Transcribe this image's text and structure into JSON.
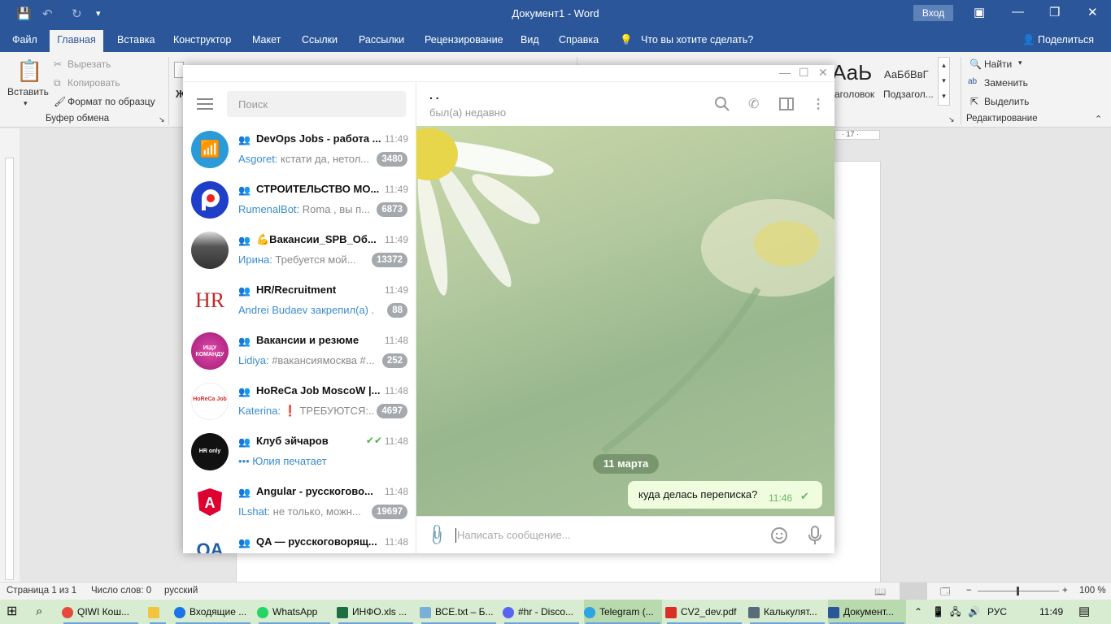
{
  "word": {
    "title": "Документ1 - Word",
    "signin": "Вход",
    "menu": [
      "Файл",
      "Главная",
      "Вставка",
      "Конструктор",
      "Макет",
      "Ссылки",
      "Рассылки",
      "Рецензирование",
      "Вид",
      "Справка"
    ],
    "tell_me": "Что вы хотите сделать?",
    "share": "Поделиться",
    "ribbon": {
      "paste": "Вставить",
      "cut": "Вырезать",
      "copy": "Копировать",
      "format_painter": "Формат по образцу",
      "clipboard_group": "Буфер обмена",
      "style_heading_sample": "АаЬ",
      "style_heading_label": "аголовок",
      "style_subtitle_sample": "АаБбВвГ",
      "style_subtitle_label": "Подзагол...",
      "find": "Найти",
      "replace": "Заменить",
      "select": "Выделить",
      "editing_group": "Редактирование",
      "ruler_mark": "· 17 ·"
    },
    "status": {
      "page": "Страница 1 из 1",
      "words": "Число слов: 0",
      "language": "русский",
      "zoom": "100 %"
    }
  },
  "telegram": {
    "search_placeholder": "Поиск",
    "chats": [
      {
        "name": "DevOps Jobs - работа ...",
        "time": "11:49",
        "sender": "Asgoret:",
        "preview": " кстати да, нетол...",
        "badge": "3480",
        "avatar_color": "#2a9ad8"
      },
      {
        "name": "СТРОИТЕЛЬСТВО МО...",
        "time": "11:49",
        "sender": "RumenalBot:",
        "preview": " Roma , вы п...",
        "badge": "6873",
        "avatar_color": "#1f3fc8"
      },
      {
        "name": "💪Вакансии_SPB_Об...",
        "time": "11:49",
        "sender": "Ирина:",
        "preview": " Требуется мой...",
        "badge": "13372",
        "avatar_color": "#4b4b4b"
      },
      {
        "name": "HR/Recruitment",
        "time": "11:49",
        "sender": "Andrei Budaev закрепил(а) ...",
        "preview": "",
        "badge": "88",
        "avatar_color": "#ffffff"
      },
      {
        "name": "Вакансии и резюме",
        "time": "11:48",
        "sender": "Lidiya:",
        "preview": " #вакансиямосква #...",
        "badge": "252",
        "avatar_color": "#c32a8f"
      },
      {
        "name": "HoReCa Job MoscoW |...",
        "time": "11:48",
        "sender": "Katerina:",
        "preview": " ❗ ТРЕБУЮТСЯ:...",
        "badge": "4697",
        "avatar_color": "#ffffff"
      },
      {
        "name": "Клуб эйчаров",
        "time": "11:48",
        "sender": "••• Юлия печатает",
        "preview": "",
        "badge": "",
        "avatar_color": "#111111"
      },
      {
        "name": "Angular - русскогово...",
        "time": "11:48",
        "sender": "ILshat:",
        "preview": " не только, можн...",
        "badge": "19697",
        "avatar_color": "#ffffff"
      },
      {
        "name": "QA — русскоговорящ...",
        "time": "11:48",
        "sender": "",
        "preview": "",
        "badge": "",
        "avatar_color": "#ffffff"
      }
    ],
    "avatar_labels": {
      "hr": "HR",
      "horeca": "HoReCa Job",
      "club": "HR only",
      "ishu": "ИЩУ КОМАНДУ",
      "qa": "QA"
    },
    "peer_name": ". .",
    "peer_status": "был(а) недавно",
    "date": "11 марта",
    "message": {
      "text": "куда делась переписка?",
      "time": "11:46"
    },
    "input_placeholder": "Написать сообщение..."
  },
  "taskbar": {
    "items": [
      "QIWI Кош...",
      "Входящие ...",
      "WhatsApp",
      "ИНФО.xls ...",
      "ВСЕ.txt – Б...",
      "#hr - Disco...",
      "Telegram (...",
      "CV2_dev.pdf",
      "Калькулят...",
      "Документ..."
    ],
    "lang": "РУС",
    "clock": "11:49"
  }
}
